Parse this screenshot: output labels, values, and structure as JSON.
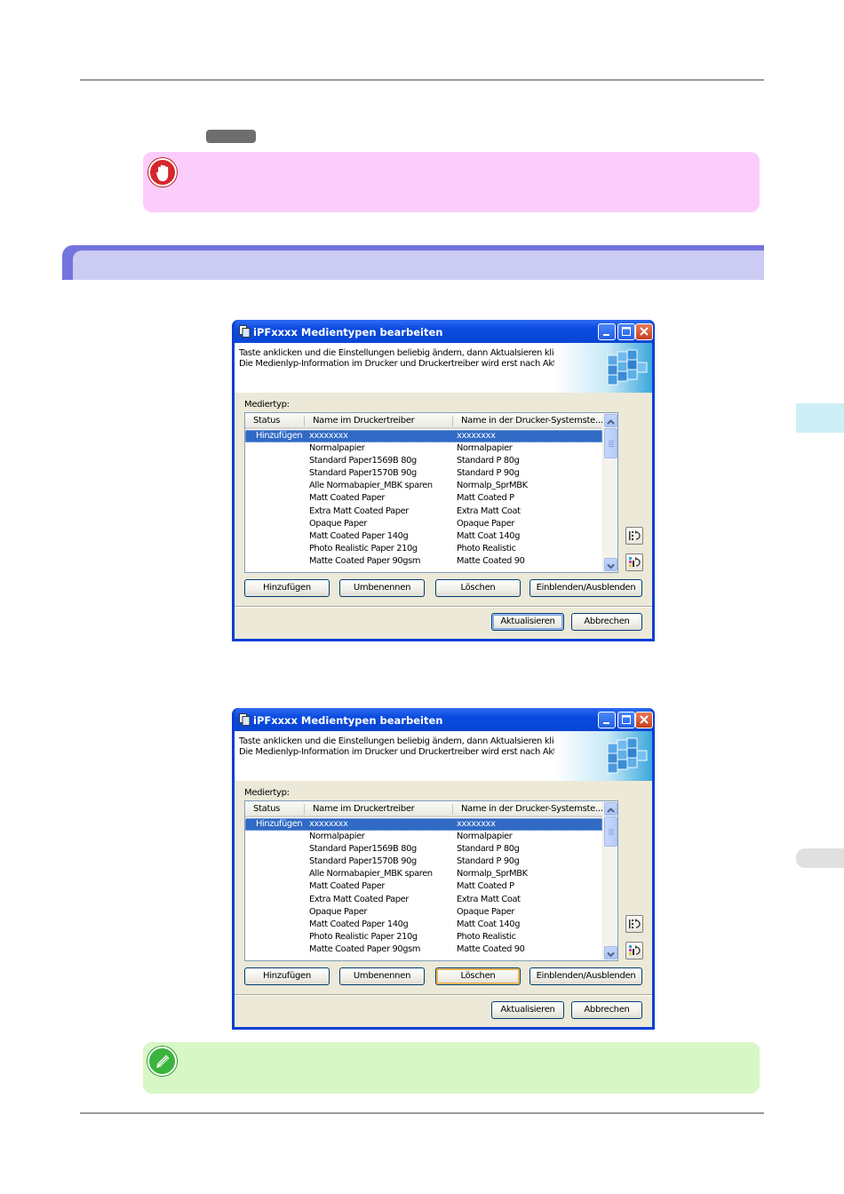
{
  "colors": {
    "important_bg": "#fccdfc",
    "note_bg": "#d7f7c6",
    "section_header": "#7474de",
    "section_header_inner": "#cbcbf4",
    "xp_title_blue": "#0a4adf",
    "selection_blue": "#316ac5"
  },
  "icons": {
    "important": "stop-hand-icon",
    "note": "pencil-icon"
  },
  "dialogs": [
    {
      "title": "iPFxxxx Medientypen bearbeiten",
      "banner_line1": "Taste anklicken und die Einstellungen beliebig ändern, dann Aktualsieren klicken.",
      "banner_line2": "Die Medienlyp-Information im Drucker und Druckertreiber wird erst nach Aktualisieren aktualsiert.",
      "medientyp_label": "Mediertyp:",
      "columns": [
        "Status",
        "Name im Druckertreiber",
        "Name in der Drucker-Systemste..."
      ],
      "rows": [
        [
          "Hinzufügen",
          "xxxxxxxx",
          "xxxxxxxx"
        ],
        [
          "",
          "Normalpapier",
          "Normalpapier"
        ],
        [
          "",
          "Standard Paper1569B 80g",
          "Standard P 80g"
        ],
        [
          "",
          "Standard Paper1570B 90g",
          "Standard P 90g"
        ],
        [
          "",
          "Alle Normabapier_MBK sparen",
          "Normalp_SprMBK"
        ],
        [
          "",
          "Matt Coated Paper",
          "Matt Coated P"
        ],
        [
          "",
          "Extra Matt Coated Paper",
          "Extra Matt Coat"
        ],
        [
          "",
          "Opaque Paper",
          "Opaque Paper"
        ],
        [
          "",
          "Matt Coated Paper 140g",
          "Matt Coat 140g"
        ],
        [
          "",
          "Photo Realistic Paper 210g",
          "Photo Realistic"
        ],
        [
          "",
          "Matte Coated Paper 90gsm",
          "Matte Coated 90"
        ]
      ],
      "selected_row": 0,
      "buttons": {
        "add": "Hinzufügen",
        "rename": "Umbenennen",
        "delete": "Löschen",
        "show_hide": "Einblenden/Ausblenden",
        "update": "Aktualisieren",
        "cancel": "Abbrechen"
      },
      "focused_button": "update"
    },
    {
      "title": "iPFxxxx Medientypen bearbeiten",
      "banner_line1": "Taste anklicken und die Einstellungen beliebig ändern, dann Aktualsieren klicken.",
      "banner_line2": "Die Medienlyp-Information im Drucker und Druckertreiber wird erst nach Aktualisieren aktualsiert.",
      "medientyp_label": "Mediertyp:",
      "columns": [
        "Status",
        "Name im Druckertreiber",
        "Name in der Drucker-Systemste..."
      ],
      "rows": [
        [
          "Hinzufügen",
          "xxxxxxxx",
          "xxxxxxxx"
        ],
        [
          "",
          "Normalpapier",
          "Normalpapier"
        ],
        [
          "",
          "Standard Paper1569B 80g",
          "Standard P 80g"
        ],
        [
          "",
          "Standard Paper1570B 90g",
          "Standard P 90g"
        ],
        [
          "",
          "Alle Normabapier_MBK sparen",
          "Normalp_SprMBK"
        ],
        [
          "",
          "Matt Coated Paper",
          "Matt Coated P"
        ],
        [
          "",
          "Extra Matt Coated Paper",
          "Extra Matt Coat"
        ],
        [
          "",
          "Opaque Paper",
          "Opaque Paper"
        ],
        [
          "",
          "Matt Coated Paper 140g",
          "Matt Coat 140g"
        ],
        [
          "",
          "Photo Realistic Paper 210g",
          "Photo Realistic"
        ],
        [
          "",
          "Matte Coated Paper 90gsm",
          "Matte Coated 90"
        ]
      ],
      "selected_row": 0,
      "buttons": {
        "add": "Hinzufügen",
        "rename": "Umbenennen",
        "delete": "Löschen",
        "show_hide": "Einblenden/Ausblenden",
        "update": "Aktualisieren",
        "cancel": "Abbrechen"
      },
      "focused_button": "delete"
    }
  ]
}
